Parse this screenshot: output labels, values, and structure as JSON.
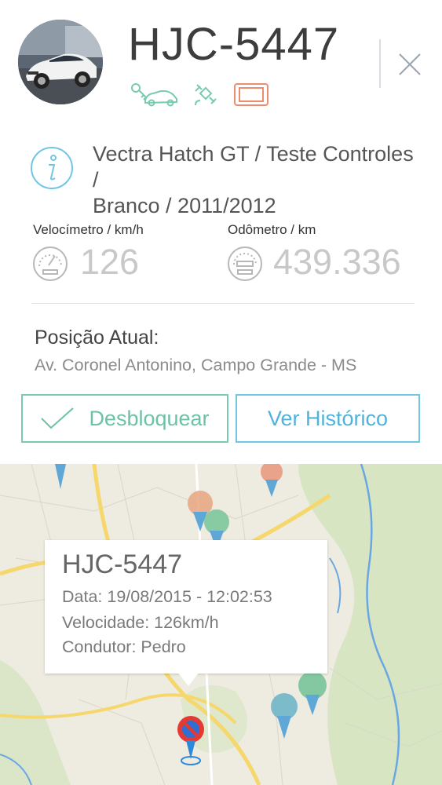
{
  "vehicle": {
    "plate": "HJC-5447",
    "description_line1": "Vectra Hatch GT / Teste Controles /",
    "description_line2": "Branco / 2011/2012"
  },
  "status_icons": [
    "car-key-icon",
    "satellite-icon",
    "tablet-icon"
  ],
  "colors": {
    "key_icon": "#79cbb0",
    "satellite_icon": "#79cbb0",
    "tablet_icon": "#f08c6e",
    "unlock": "#6bc3a5",
    "history": "#4fb3dc",
    "info": "#71c6e4"
  },
  "metrics": {
    "speed_label": "Velocímetro / km/h",
    "speed_value": "126",
    "odometer_label": "Odômetro / km",
    "odometer_value": "439.336"
  },
  "position": {
    "title": "Posição Atual:",
    "address": "Av. Coronel Antonino, Campo Grande - MS"
  },
  "buttons": {
    "unlock": "Desbloquear",
    "history": "Ver Histórico"
  },
  "map_popup": {
    "title": "HJC-5447",
    "date": "Data: 19/08/2015 - 12:02:53",
    "speed": "Velocidade: 126km/h",
    "driver": "Condutor: Pedro"
  }
}
